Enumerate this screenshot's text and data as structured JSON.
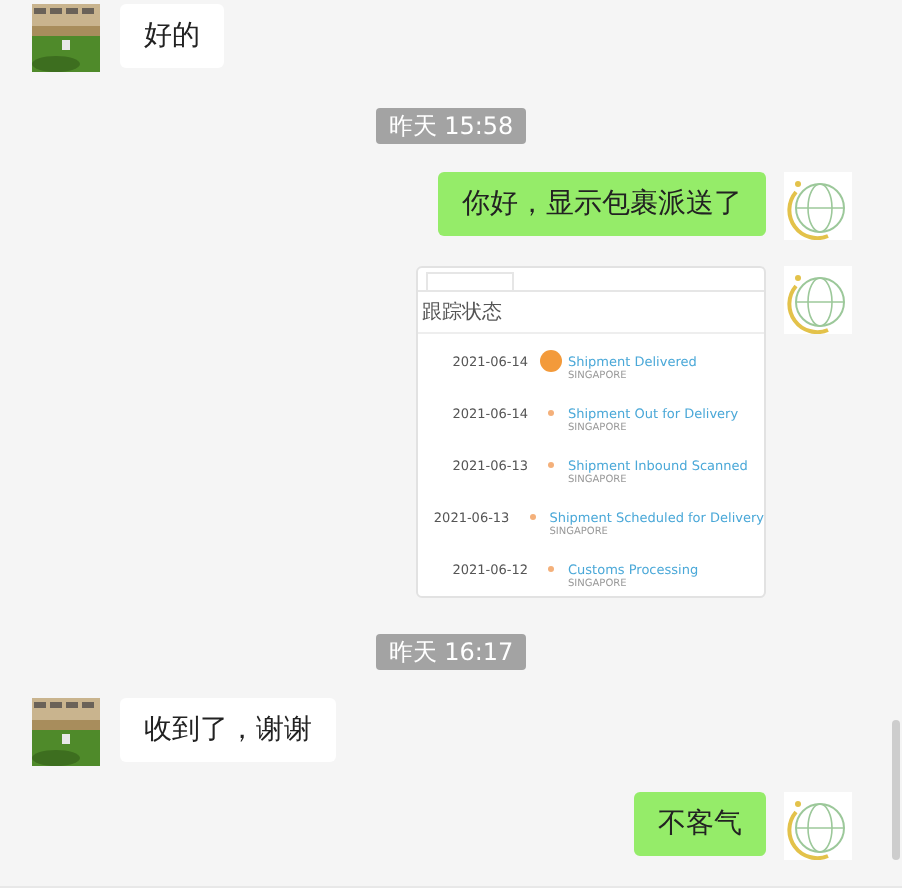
{
  "messages": [
    {
      "kind": "text",
      "from_me": false,
      "text": "好的"
    },
    {
      "kind": "time",
      "text": "昨天 15:58"
    },
    {
      "kind": "text",
      "from_me": true,
      "text": "你好，显示包裹派送了"
    },
    {
      "from_me": true,
      "heading": "跟踪状态",
      "events": [
        {
          "date": "2021-06-14",
          "status": "Shipment Delivered",
          "place": "SINGAPORE",
          "current": true
        },
        {
          "date": "2021-06-14",
          "status": "Shipment Out for Delivery",
          "place": "SINGAPORE",
          "current": false
        },
        {
          "date": "2021-06-13",
          "status": "Shipment Inbound Scanned",
          "place": "SINGAPORE",
          "current": false
        },
        {
          "date": "2021-06-13",
          "status": "Shipment Scheduled for Delivery",
          "place": "SINGAPORE",
          "current": false
        },
        {
          "date": "2021-06-12",
          "status": "Customs Processing",
          "place": "SINGAPORE",
          "current": false
        }
      ]
    },
    {
      "kind": "time",
      "text": "昨天 16:17"
    },
    {
      "kind": "text",
      "from_me": false,
      "text": "收到了，谢谢"
    },
    {
      "kind": "text",
      "from_me": true,
      "text": "不客气"
    }
  ]
}
